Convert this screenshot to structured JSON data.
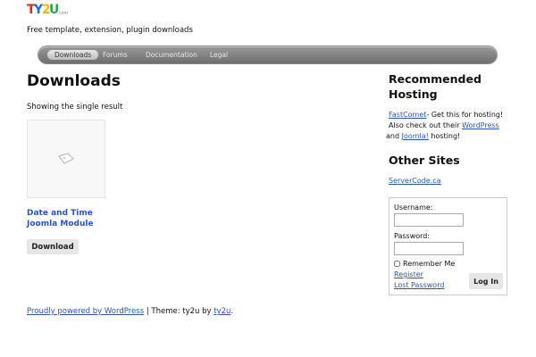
{
  "header": {
    "logo_text": "TY2U.com",
    "tagline": "Free template, extension, plugin downloads"
  },
  "nav": {
    "items": [
      "Downloads",
      "Forums",
      "Documentation",
      "Legal"
    ]
  },
  "main": {
    "title": "Downloads",
    "result_count": "Showing the single result",
    "product": {
      "title_line1": "Date and Time",
      "title_line2": "Joomla Module",
      "button_label": "Download",
      "image_icon": "image-placeholder-icon"
    }
  },
  "footer": {
    "powered": "Proudly powered by WordPress",
    "sep": " | Theme: ty2u by ",
    "theme_link": "ty2u",
    "end": "."
  },
  "sidebar": {
    "hosting_heading": "Recommended Hosting",
    "fastcomet_link": "FastComet",
    "hosting_text1": "- Get this for hosting! Also check out their ",
    "wordpress_link": "WordPress",
    "and_text": " and ",
    "joomla_link": "Joomla!",
    "hosting_text2": " hosting!",
    "other_heading": "Other Sites",
    "servercode_link": "ServerCode.ca",
    "login": {
      "username_label": "Username:",
      "username_value": "",
      "password_label": "Password:",
      "password_value": "",
      "remember_label": "Remember Me",
      "register_link": "Register",
      "lost_password_link": "Lost Password",
      "login_button": "Log In"
    }
  }
}
